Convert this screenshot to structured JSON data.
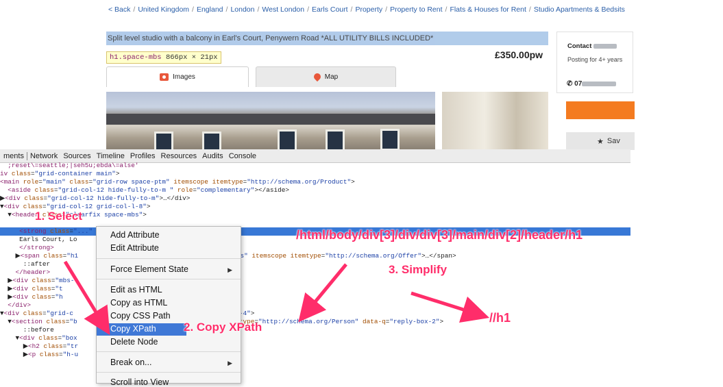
{
  "website": {
    "breadcrumb": [
      "< Back",
      "United Kingdom",
      "England",
      "London",
      "West London",
      "Earls Court",
      "Property",
      "Property to Rent",
      "Flats & Houses for Rent",
      "Studio Apartments & Bedsits"
    ],
    "listing_title": "Split level studio with a balcony in Earl's Court, Penywern Road *ALL UTILITY BILLS INCLUDED*",
    "dimension_tag": "h1.space-mbs",
    "dimension_size": "866px × 21px",
    "price": "£350.00pw",
    "tabs": [
      {
        "label": "Images",
        "icon": "camera-icon"
      },
      {
        "label": "Map",
        "icon": "map-pin-icon"
      }
    ],
    "contact_label": "Contact",
    "posting_text": "Posting for 4+ years",
    "phone_prefix": "07",
    "save_label": "Sav",
    "colors": {
      "accent": "#f47b20",
      "link": "#2a5ea8",
      "highlight": "#a9c6e8"
    }
  },
  "devtools": {
    "tabs": [
      "ments",
      "Network",
      "Sources",
      "Timeline",
      "Profiles",
      "Resources",
      "Audits",
      "Console"
    ],
    "code_lines": [
      {
        "html": "<span class=\"t\">  ;reset\\=seattle;|seh5u;ebda\\=alse'</span>"
      },
      {
        "html": "<span class=\"t\">iv</span> <span class=\"an\">class</span>=<span class=\"av\">\"grid-container main\"</span>&gt;"
      },
      {
        "html": "<span class=\"t\">&lt;main</span> <span class=\"an\">role</span>=<span class=\"av\">\"main\"</span> <span class=\"an\">class</span>=<span class=\"av\">\"grid-row space-ptm\"</span> <span class=\"an\">itemscope</span> <span class=\"an\">itemtype</span>=<span class=\"av\">\"http://schema.org/Product\"</span>&gt;"
      },
      {
        "html": "  <span class=\"t\">&lt;aside</span> <span class=\"an\">class</span>=<span class=\"av\">\"grid-col-12 hide-fully-to-m \"</span> <span class=\"an\">role</span>=<span class=\"av\">\"complementary\"</span>&gt;&lt;/aside&gt;"
      },
      {
        "html": "▶<span class=\"t\">&lt;div</span> <span class=\"an\">class</span>=<span class=\"av\">\"grid-col-12 hide-fully-to-m\"</span>&gt;…&lt;/div&gt;"
      },
      {
        "html": "▼<span class=\"t\">&lt;div</span> <span class=\"an\">class</span>=<span class=\"av\">\"grid-col-12 grid-col-l-8\"</span>&gt;"
      },
      {
        "html": "  ▼<span class=\"t\">&lt;header</span> <span class=\"an\">class</span>=<span class=\"av\">\"clearfix space-mbs\"</span>&gt;"
      },
      {
        "html": "    ▶&lt;h1 itemprop=\"name\" class=\"space-mbs\"&gt;…&lt;/h1&gt; == $0",
        "selected": true
      },
      {
        "html": "     <span class=\"t\">&lt;strong</span> <span class=\"an\">class</span>=<span class=\"av\">\"...\"</span>          <span class=\"an\">...ft\"</span> <span class=\"an\">itemscope</span>"
      },
      {
        "html": "     Earls Court, Lo"
      },
      {
        "html": "     <span class=\"t\">&lt;/strong&gt;</span>"
      },
      {
        "html": "    ▶<span class=\"t\">&lt;span</span> <span class=\"an\">class</span>=<span class=\"av\">\"h1</span>                                     <span class=\"av\">offers\"</span> <span class=\"an\">itemscope</span> <span class=\"an\">itemtype</span>=<span class=\"av\">\"http://schema.org/Offer\"</span>&gt;…&lt;/span&gt;"
      },
      {
        "html": "      ::after"
      },
      {
        "html": "    <span class=\"t\">&lt;/header&gt;</span>"
      },
      {
        "html": "  ▶<span class=\"t\">&lt;div</span> <span class=\"an\">class</span>=<span class=\"av\">\"mbs-</span>"
      },
      {
        "html": "  ▶<span class=\"t\">&lt;div</span> <span class=\"an\">class</span>=<span class=\"av\">\"t</span>"
      },
      {
        "html": "  ▶<span class=\"t\">&lt;div</span> <span class=\"an\">class</span>=<span class=\"av\">\"h</span>"
      },
      {
        "html": "  <span class=\"t\">&lt;/div&gt;</span>"
      },
      {
        "html": "▼<span class=\"t\">&lt;div</span> <span class=\"an\">class</span>=<span class=\"av\">\"grid-c</span>                                     <span class=\"av\">-col-l-4\"</span>&gt;"
      },
      {
        "html": "  ▼<span class=\"t\">&lt;section</span> <span class=\"an\">class</span>=<span class=\"av\">\"b</span>                                      <span class=\"an\">itemtype</span>=<span class=\"av\">\"http://schema.org/Person\"</span> <span class=\"an\">data-q</span>=<span class=\"av\">\"reply-box-2\"</span>&gt;"
      },
      {
        "html": "      ::before"
      },
      {
        "html": "    ▼<span class=\"t\">&lt;div</span> <span class=\"an\">class</span>=<span class=\"av\">\"box</span>"
      },
      {
        "html": "      ▶<span class=\"t\">&lt;h2</span> <span class=\"an\">class</span>=<span class=\"av\">\"tr</span>"
      },
      {
        "html": "      ▶<span class=\"t\">&lt;p</span> <span class=\"an\">class</span>=<span class=\"av\">\"h-u</span>"
      }
    ],
    "context_menu": [
      {
        "label": "Add Attribute"
      },
      {
        "label": "Edit Attribute"
      },
      {
        "label": "Force Element State",
        "submenu": true
      },
      {
        "label": "Edit as HTML"
      },
      {
        "label": "Copy as HTML"
      },
      {
        "label": "Copy CSS Path"
      },
      {
        "label": "Copy XPath",
        "highlighted": true
      },
      {
        "label": "Delete Node"
      },
      {
        "label": "Break on...",
        "submenu": true
      },
      {
        "label": "Scroll into View"
      }
    ]
  },
  "annotations": {
    "step1": "1. Select",
    "step2": "2. Copy XPath",
    "step3": "3. Simplify",
    "full_xpath": "/html/body/div[3]/div/div[3]/main/div[2]/header/h1",
    "simple_xpath": "//h1",
    "color": "#ff2d6a"
  }
}
